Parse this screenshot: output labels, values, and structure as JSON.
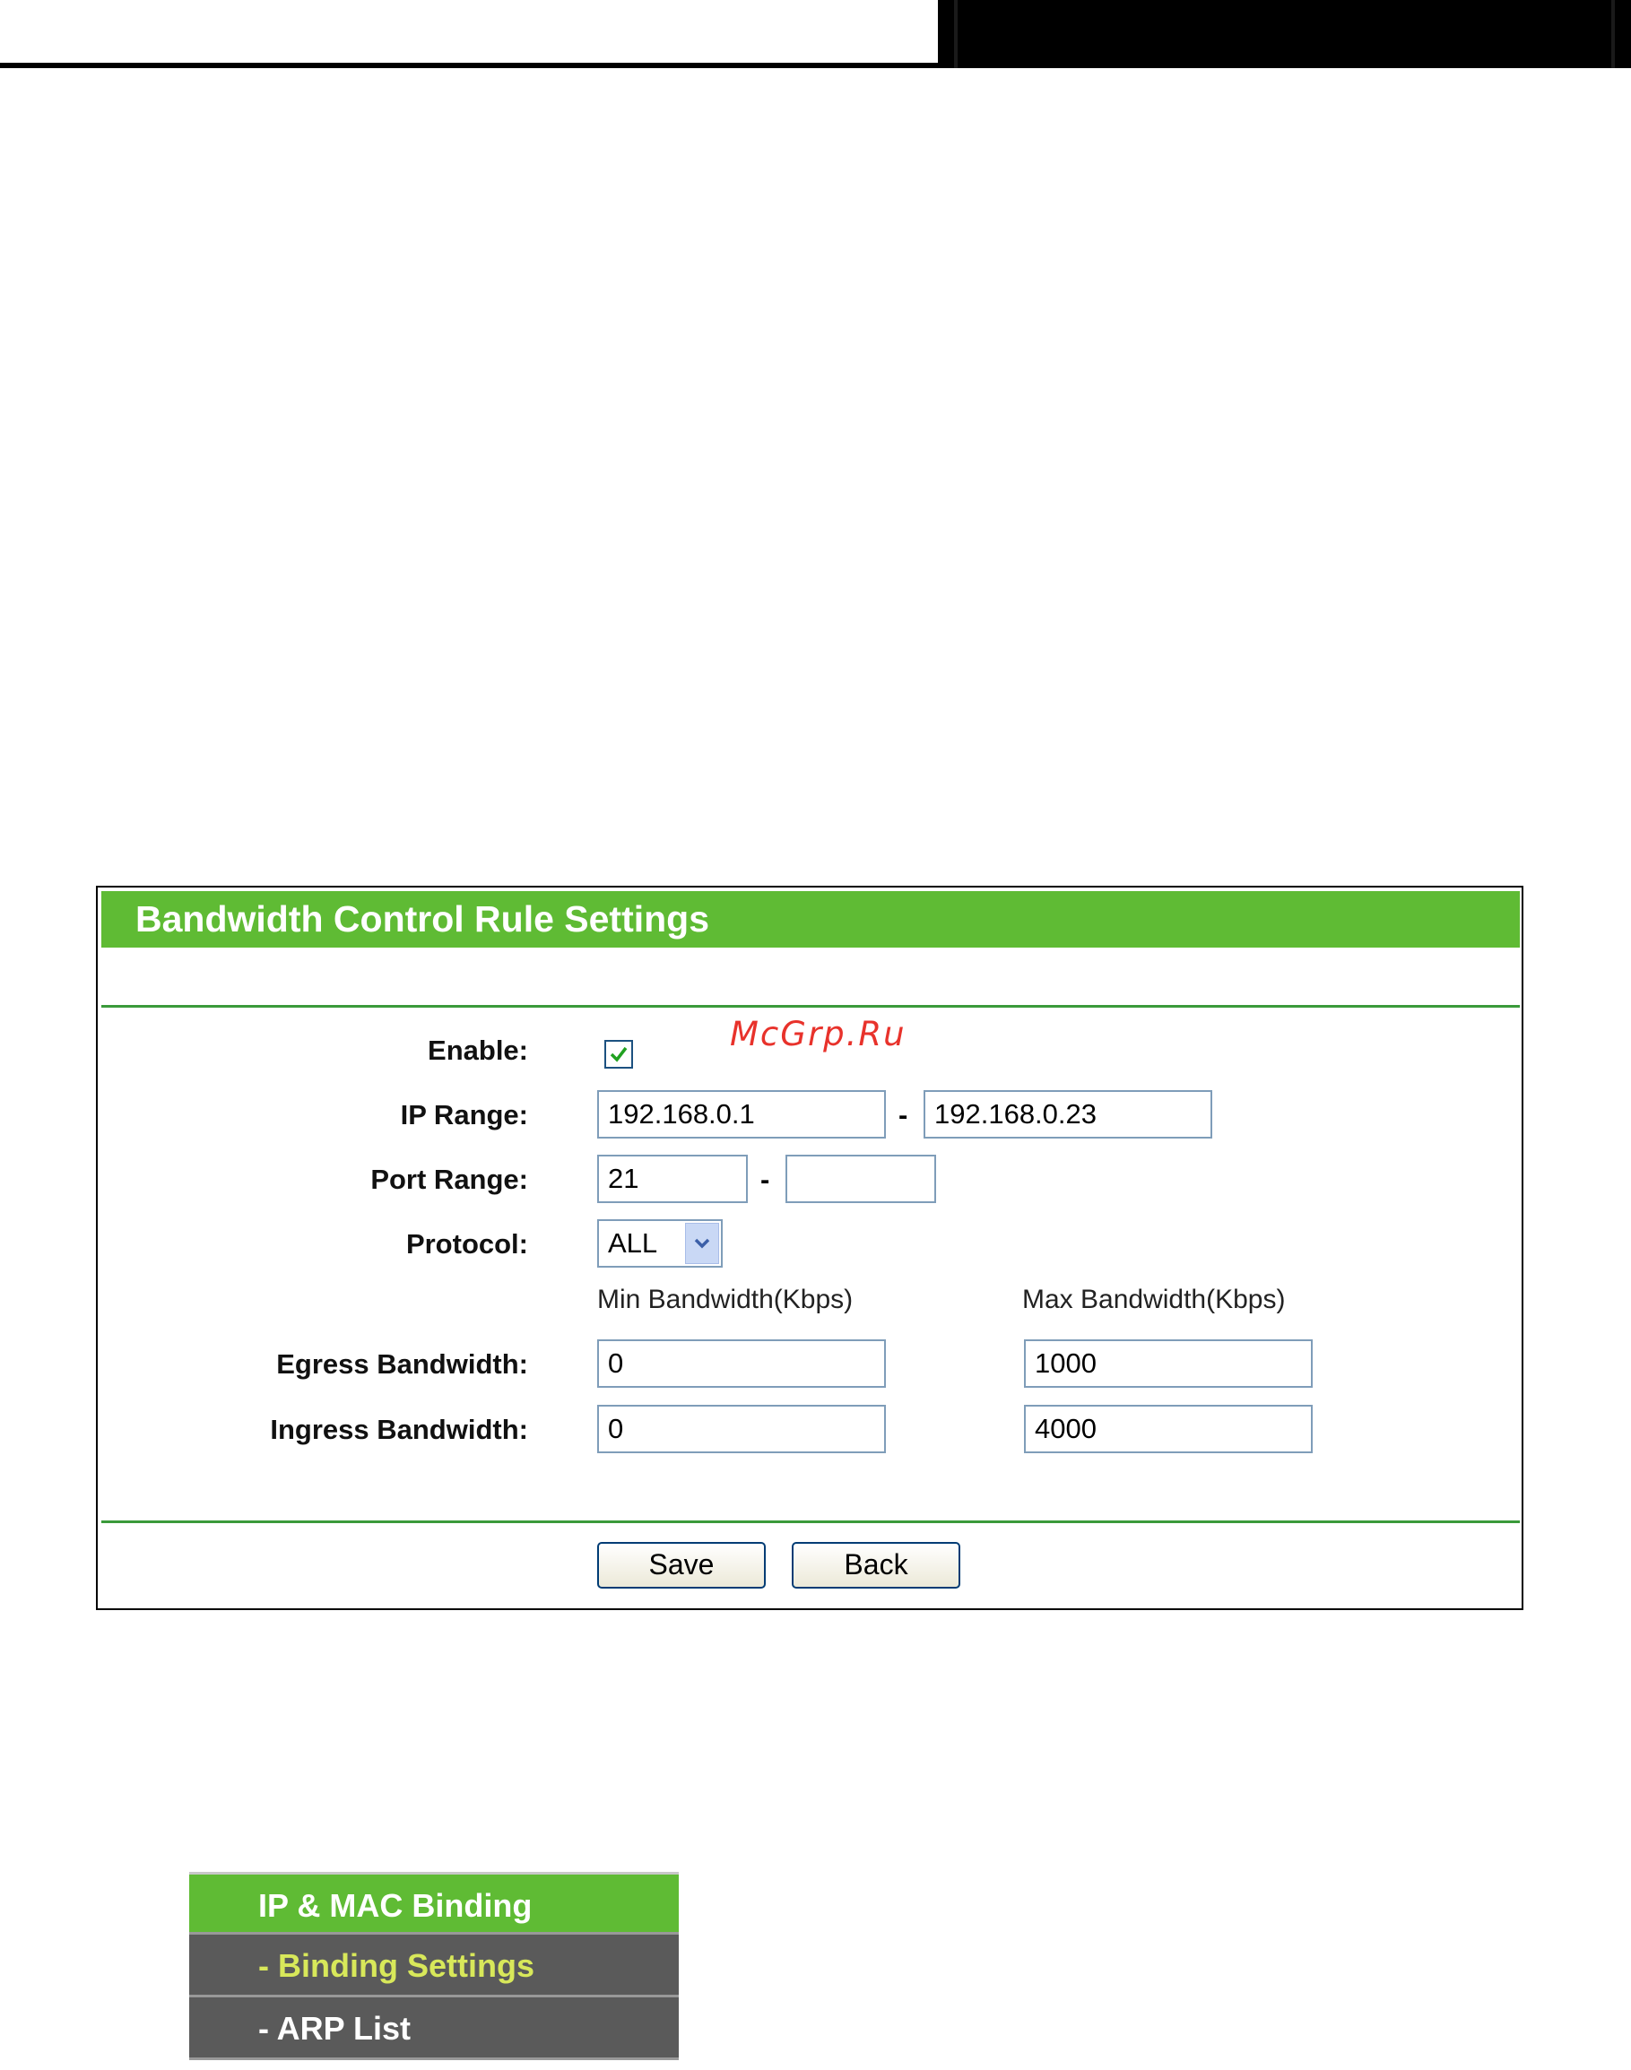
{
  "panel": {
    "title": "Bandwidth Control Rule Settings",
    "enable": {
      "label": "Enable:",
      "checked": true
    },
    "ip_range": {
      "label": "IP Range:",
      "start": "192.168.0.1",
      "end": "192.168.0.23",
      "separator": "-"
    },
    "port_range": {
      "label": "Port Range:",
      "start": "21",
      "end": "",
      "separator": "-"
    },
    "protocol": {
      "label": "Protocol:",
      "selected": "ALL"
    },
    "columns": {
      "min": "Min Bandwidth(Kbps)",
      "max": "Max Bandwidth(Kbps)"
    },
    "egress": {
      "label": "Egress Bandwidth:",
      "min": "0",
      "max": "1000"
    },
    "ingress": {
      "label": "Ingress Bandwidth:",
      "min": "0",
      "max": "4000"
    },
    "buttons": {
      "save": "Save",
      "back": "Back"
    }
  },
  "watermark": "McGrp.Ru",
  "menu": {
    "items": [
      {
        "label": "IP & MAC Binding"
      },
      {
        "label": "- Binding Settings"
      },
      {
        "label": "- ARP List"
      }
    ]
  },
  "colors": {
    "accent_green": "#5fbb34",
    "menu_gray": "#5a5a5a",
    "active_text": "#d8e85a"
  }
}
